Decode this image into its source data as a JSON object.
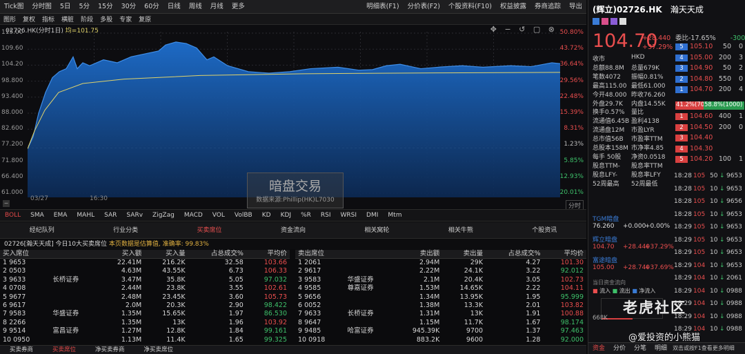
{
  "app": {
    "menus": [
      "Tick图",
      "分时图",
      "5日",
      "5分",
      "15分",
      "30分",
      "60分",
      "日线",
      "周线",
      "月线",
      "更多"
    ],
    "right_menus": [
      "明细表(F1)",
      "分价表(F2)",
      "个股资料(F10)",
      "权益披露",
      "券商追踪",
      "导出"
    ],
    "toolbar": [
      "图形",
      "复权",
      "指标",
      "横脏",
      "阶段",
      "多股",
      "专家",
      "复原"
    ]
  },
  "chart": {
    "title": "02726.HK(分时1日)",
    "avg_label": "均=101.75",
    "y_left": [
      "115.00",
      "109.60",
      "104.20",
      "98.800",
      "93.400",
      "88.000",
      "82.600",
      "77.200",
      "71.800",
      "66.400",
      "61.000"
    ],
    "y_right": [
      "50.80%",
      "43.72%",
      "36.64%",
      "29.56%",
      "22.48%",
      "15.39%",
      "8.31%",
      "1.23%",
      "5.85%",
      "12.93%",
      "20.01%"
    ],
    "x_labels": [
      "03/27",
      "16:30"
    ],
    "x_right": "分时",
    "prev_close": 76.26
  },
  "watermark": {
    "title": "暗盘交易",
    "sub": "数据来源:Phillip(HK)L7030"
  },
  "indicators": [
    "BOLL",
    "SMA",
    "EMA",
    "MAHL",
    "SAR",
    "SARv",
    "ZigZag",
    "MACD",
    "VOL",
    "VolBB",
    "KD",
    "KDJ",
    "%R",
    "RSI",
    "WRSI",
    "DMI",
    "Mtm"
  ],
  "tabs": [
    "经纪队列",
    "行业分类",
    "买卖席位",
    "资金流向",
    "相关窝轮",
    "相关牛熊",
    "个股资讯"
  ],
  "info": {
    "text": "02726[瀚天天成]  今日10大买卖席位",
    "note": "本页数据是估算值,",
    "acc": "准确率: 99.83%"
  },
  "buy_headers": [
    "买入席位",
    "买入额",
    "买入量",
    "占总成交%",
    "平均价"
  ],
  "buy_rows": [
    [
      "1  9653",
      "",
      "22.41M",
      "216.2K",
      "32.58",
      "103.66"
    ],
    [
      "2  0503",
      "",
      "4.63M",
      "43.55K",
      "6.73",
      "106.33"
    ],
    [
      "3  9633",
      "长桥证券",
      "3.47M",
      "35.8K",
      "5.05",
      "97.032"
    ],
    [
      "4  0708",
      "",
      "2.44M",
      "23.8K",
      "3.55",
      "102.61"
    ],
    [
      "5  9677",
      "",
      "2.48M",
      "23.45K",
      "3.60",
      "105.73"
    ],
    [
      "6  9617",
      "",
      "2.0M",
      "20.3K",
      "2.90",
      "98.422"
    ],
    [
      "7  9583",
      "华盛证券",
      "1.35M",
      "15.65K",
      "1.97",
      "86.530"
    ],
    [
      "8  2266",
      "",
      "1.35M",
      "13K",
      "1.96",
      "103.92"
    ],
    [
      "9  9514",
      "富昌证券",
      "1.27M",
      "12.8K",
      "1.84",
      "99.161"
    ],
    [
      "10  0950",
      "",
      "1.13M",
      "11.4K",
      "1.65",
      "99.325"
    ]
  ],
  "sell_headers": [
    "卖出席位",
    "卖出额",
    "卖出量",
    "占总成交%",
    "平均价"
  ],
  "sell_rows": [
    [
      "1  2061",
      "",
      "2.94M",
      "29K",
      "4.27",
      "101.30"
    ],
    [
      "2  9617",
      "",
      "2.22M",
      "24.1K",
      "3.22",
      "92.012"
    ],
    [
      "3  9583",
      "华盛证券",
      "2.1M",
      "20.4K",
      "3.05",
      "102.73"
    ],
    [
      "4  9585",
      "尊嘉证券",
      "1.53M",
      "14.65K",
      "2.22",
      "104.11"
    ],
    [
      "5  9656",
      "",
      "1.34M",
      "13.95K",
      "1.95",
      "95.999"
    ],
    [
      "6  0052",
      "",
      "1.38M",
      "13.3K",
      "2.01",
      "103.82"
    ],
    [
      "7  9633",
      "长桥证券",
      "1.31M",
      "13K",
      "1.91",
      "100.88"
    ],
    [
      "8  9647",
      "",
      "1.15M",
      "11.7K",
      "1.67",
      "98.174"
    ],
    [
      "9  9485",
      "哈富证券",
      "945.39K",
      "9700",
      "1.37",
      "97.463"
    ],
    [
      "10  0918",
      "",
      "883.2K",
      "9600",
      "1.28",
      "92.000"
    ]
  ],
  "bottom_tabs": [
    "买卖券商",
    "买卖席位",
    "净买卖券商",
    "净买卖席位"
  ],
  "right": {
    "code": "(辉立)02726.HK",
    "name": "瀚天天成",
    "price": "104.70",
    "chg": "+28.440",
    "pct": "+37.29%",
    "stats": [
      [
        "收市",
        "HKD"
      ],
      [
        "总额88.8M",
        "总量679K"
      ],
      [
        "笔数4072",
        "振幅0.81%"
      ],
      [
        "最高115.00",
        "最低61.000"
      ],
      [
        "今开48.000",
        "昨收76.260"
      ],
      [
        "外盘29.7K",
        "内盘14.55K"
      ],
      [
        "换手0.57%",
        "量比"
      ],
      [
        "流通值6.45B",
        "盈利4138"
      ],
      [
        "流通盘12M",
        "市盈LYR"
      ],
      [
        "总市值56B",
        "市盈率TTM"
      ],
      [
        "总股本158M",
        "市净率4.85"
      ],
      [
        "每手 50股",
        "净资0.0518"
      ],
      [
        "股息TTM-",
        "股息率TTM"
      ],
      [
        "股息LFY-",
        "股息率LFY"
      ],
      [
        "52周最高",
        "52周最低"
      ]
    ],
    "weibi": "委比-17.65%",
    "weicha": "-300",
    "asks": [
      [
        "5",
        "105.10",
        "50",
        "0"
      ],
      [
        "4",
        "105.00",
        "200",
        "3"
      ],
      [
        "3",
        "104.90",
        "50",
        "2"
      ],
      [
        "2",
        "104.80",
        "550",
        "0"
      ],
      [
        "1",
        "104.70",
        "200",
        "4"
      ]
    ],
    "bidask_ratio": "41.2%(700)",
    "bidask_ratio2": "58.8%(1000)",
    "bids": [
      [
        "1",
        "104.60",
        "400",
        "1"
      ],
      [
        "2",
        "104.50",
        "200",
        "0"
      ],
      [
        "3",
        "104.40",
        "",
        ""
      ],
      [
        "4",
        "104.30",
        "",
        ""
      ],
      [
        "5",
        "104.20",
        "100",
        "1"
      ]
    ],
    "dark": [
      [
        "TGM暗盘",
        "76.260",
        "+0.000",
        "+0.00%"
      ],
      [
        "辉立暗盘",
        "104.70",
        "+28.440",
        "+37.29%"
      ],
      [
        "富途暗盘",
        "105.00",
        "+28.740",
        "+37.69%"
      ]
    ],
    "flow_label": "当日资金流向",
    "flow_legend": [
      "流入",
      "流出",
      "净流入"
    ],
    "flow_val": "668K",
    "ticks": [
      [
        "18:28",
        "105",
        "50",
        "9653"
      ],
      [
        "18:28",
        "105",
        "10",
        "9653"
      ],
      [
        "18:28",
        "105",
        "10",
        "9656"
      ],
      [
        "18:28",
        "105",
        "10",
        "9653"
      ],
      [
        "18:29",
        "105",
        "10",
        "9653"
      ],
      [
        "18:29",
        "105",
        "10",
        "9653"
      ],
      [
        "18:29",
        "105",
        "10",
        "9653"
      ],
      [
        "18:29",
        "104",
        "10",
        "9653"
      ],
      [
        "18:29",
        "104",
        "10",
        "2061"
      ],
      [
        "18:29",
        "104",
        "10",
        "0988"
      ],
      [
        "18:29",
        "104",
        "10",
        "0988"
      ],
      [
        "18:29",
        "104",
        "10",
        "0988"
      ],
      [
        "18:29",
        "104",
        "10",
        "0988"
      ]
    ],
    "footer_tabs": [
      "资金",
      "分价",
      "分笔",
      "明细"
    ],
    "footer_note": "双击或按F1查看更多明细",
    "watermark_site": "老虎社区",
    "watermark_user": "@爱投资的小熊猫"
  }
}
